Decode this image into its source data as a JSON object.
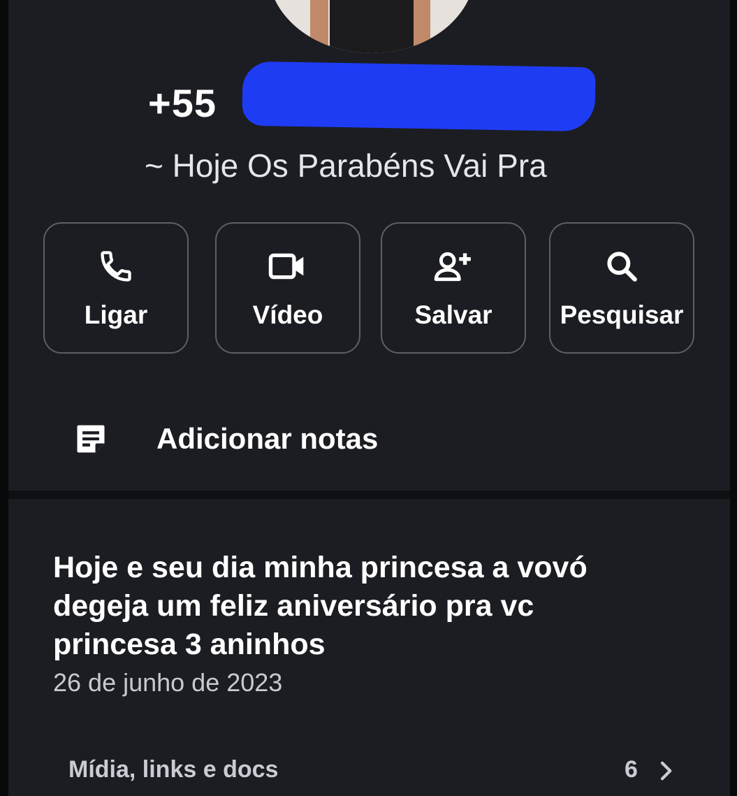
{
  "contact": {
    "phone_prefix": "+55",
    "status": "~ Hoje Os Parabéns Vai Pra"
  },
  "actions": [
    {
      "label": "Ligar",
      "icon": "phone-icon"
    },
    {
      "label": "Vídeo",
      "icon": "video-icon"
    },
    {
      "label": "Salvar",
      "icon": "add-contact-icon"
    },
    {
      "label": "Pesquisar",
      "icon": "search-icon"
    }
  ],
  "notes": {
    "label": "Adicionar notas",
    "icon": "note-icon"
  },
  "about": {
    "line1": "Hoje e seu dia minha princesa a vovó",
    "line2": "degeja um feliz aniversário pra vc",
    "line3": "princesa 3 aninhos",
    "date": "26 de junho de 2023"
  },
  "media": {
    "label": "Mídia, links e docs",
    "count": "6",
    "icon": "chevron-right-icon"
  },
  "colors": {
    "background": "#1b1d22",
    "redaction": "#1f3cf5",
    "border": "#5b5f67"
  }
}
